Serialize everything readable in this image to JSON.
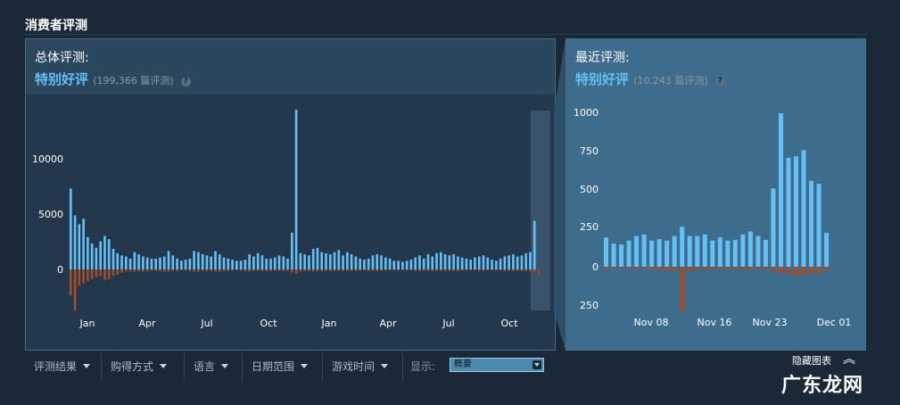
{
  "section_title": "消费者评测",
  "overall": {
    "label": "总体评测:",
    "rating": "特别好评",
    "count": "(199,366 篇评测)",
    "help": "?"
  },
  "recent": {
    "label": "最近评测:",
    "rating": "特别好评",
    "count": "(10,243 篇评测)",
    "help": "?"
  },
  "filters": {
    "review_type": "评测结果",
    "purchase_type": "购得方式",
    "language": "语言",
    "date_range": "日期范围",
    "playtime": "游戏时间",
    "display_label": "显示:",
    "display_value": "概要",
    "hide_chart": "隐藏图表",
    "hide_chart_icon": "︽"
  },
  "watermark": "广东龙网",
  "colors": {
    "positive": "#66c0f4",
    "negative": "#a34c25",
    "background": "#1b2838"
  },
  "chart_data": [
    {
      "type": "bar",
      "title": "总体评测",
      "x_tick_labels": [
        "Jan",
        "Apr",
        "Jul",
        "Oct",
        "Jan",
        "Apr",
        "Jul",
        "Oct"
      ],
      "y_tick_labels": [
        "10000",
        "5000",
        "0"
      ],
      "ylim": [
        -4000,
        15000
      ],
      "grid": false,
      "series": [
        {
          "values": [
            7500,
            5000,
            4200,
            4700,
            3000,
            2400,
            2000,
            2600,
            3100,
            2800,
            1900,
            1500,
            1300,
            1200,
            1000,
            1600,
            1400,
            1200,
            1100,
            1000,
            1000,
            1100,
            1200,
            1700,
            1300,
            1000,
            800,
            900,
            1000,
            1700,
            1600,
            1400,
            1300,
            1200,
            1700,
            1400,
            1100,
            1000,
            900,
            800,
            800,
            900,
            1400,
            1200,
            1500,
            1300,
            1000,
            1000,
            1100,
            1300,
            1200,
            1000,
            3400,
            14800,
            1500,
            1400,
            1300,
            1900,
            2000,
            1600,
            1500,
            1400,
            1600,
            1800,
            1300,
            1600,
            1400,
            1200,
            1000,
            900,
            1000,
            1300,
            1400,
            1300,
            1100,
            1000,
            800,
            800,
            700,
            800,
            900,
            1100,
            1300,
            1000,
            1400,
            1200,
            1500,
            1600,
            1400,
            1300,
            1400,
            1200,
            1100,
            1000,
            900,
            1100,
            1200,
            1300,
            1100,
            900,
            800,
            1000,
            1200,
            1300,
            1400,
            1200,
            1300,
            1500,
            1600,
            4500
          ]
        },
        {
          "values": [
            -2400,
            -3800,
            -1500,
            -1300,
            -1100,
            -900,
            -700,
            -600,
            -1000,
            -900,
            -600,
            -500,
            -300,
            -200,
            -200,
            -200,
            -200,
            -200,
            -200,
            -150,
            -150,
            -150,
            -200,
            -200,
            -150,
            -150,
            -100,
            -100,
            -150,
            -200,
            -200,
            -150,
            -150,
            -150,
            -200,
            -200,
            -150,
            -150,
            -100,
            -100,
            -100,
            -150,
            -200,
            -150,
            -150,
            -150,
            -150,
            -150,
            -150,
            -150,
            -150,
            -150,
            -300,
            -400,
            -200,
            -150,
            -150,
            -200,
            -200,
            -150,
            -150,
            -150,
            -150,
            -150,
            -150,
            -150,
            -150,
            -150,
            -100,
            -100,
            -150,
            -150,
            -150,
            -150,
            -100,
            -100,
            -100,
            -100,
            -100,
            -100,
            -100,
            -150,
            -150,
            -100,
            -150,
            -150,
            -150,
            -150,
            -150,
            -150,
            -150,
            -150,
            -100,
            -100,
            -100,
            -100,
            -150,
            -150,
            -100,
            -100,
            -100,
            -100,
            -150,
            -150,
            -150,
            -150,
            -150,
            -150,
            -200,
            -200,
            -400
          ]
        }
      ]
    },
    {
      "type": "bar",
      "title": "最近评测",
      "x_tick_labels": [
        "Nov 08",
        "Nov 16",
        "Nov 23",
        "Dec 01"
      ],
      "y_tick_labels": [
        "1000",
        "750",
        "500",
        "250",
        "0",
        "250"
      ],
      "ylim": [
        -300,
        1000
      ],
      "grid": false,
      "series": [
        {
          "values": [
            190,
            150,
            145,
            170,
            200,
            210,
            170,
            180,
            170,
            200,
            260,
            200,
            200,
            210,
            170,
            190,
            170,
            175,
            210,
            230,
            200,
            175,
            510,
            1000,
            710,
            720,
            760,
            560,
            540,
            220
          ]
        },
        {
          "values": [
            -15,
            -10,
            -10,
            -10,
            -15,
            -10,
            -20,
            -20,
            -30,
            -25,
            -290,
            -30,
            -20,
            -20,
            -15,
            -15,
            -15,
            -15,
            -20,
            -20,
            -15,
            -15,
            -30,
            -40,
            -50,
            -60,
            -60,
            -45,
            -45,
            -20
          ]
        }
      ]
    }
  ]
}
